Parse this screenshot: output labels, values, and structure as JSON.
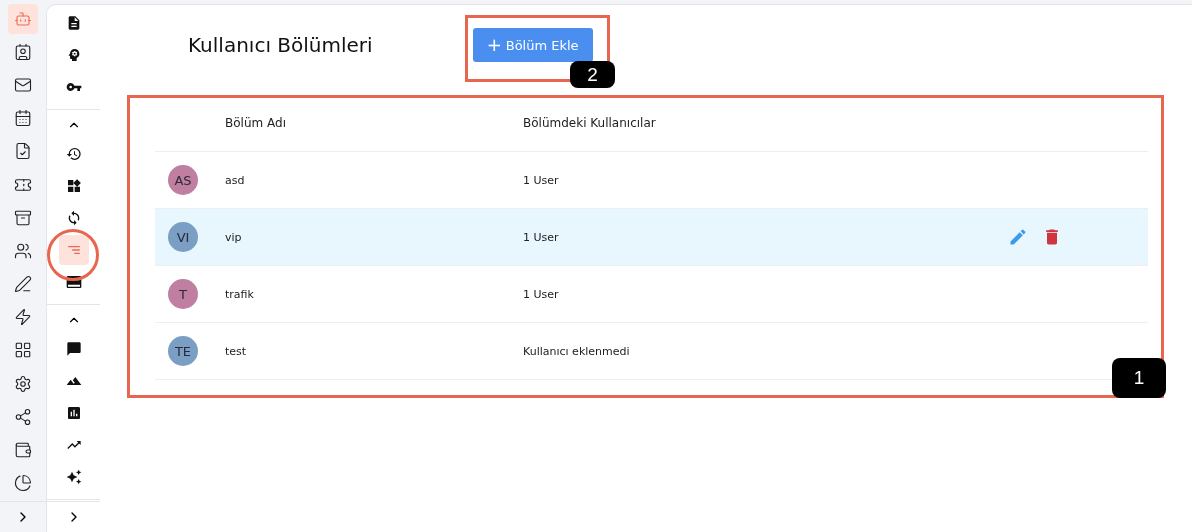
{
  "primary_nav": [
    {
      "selected": true
    },
    {
      "selected": false
    },
    {
      "selected": false
    },
    {
      "selected": false
    },
    {
      "selected": false
    },
    {
      "selected": false
    },
    {
      "selected": false
    },
    {
      "selected": false
    },
    {
      "selected": false
    },
    {
      "selected": false
    },
    {
      "selected": false
    },
    {
      "selected": false
    },
    {
      "selected": false
    },
    {
      "selected": false
    },
    {
      "selected": false
    }
  ],
  "secondary_nav": {
    "groups": [
      {
        "items": [
          {
            "selected": false
          },
          {
            "selected": false
          },
          {
            "selected": false
          }
        ]
      },
      {
        "items": [
          {
            "selected": false
          },
          {
            "selected": false
          },
          {
            "selected": false
          },
          {
            "selected": true
          },
          {
            "selected": false
          }
        ]
      },
      {
        "items": [
          {
            "selected": false
          },
          {
            "selected": false
          },
          {
            "selected": false
          },
          {
            "selected": false
          },
          {
            "selected": false
          }
        ]
      }
    ]
  },
  "page": {
    "title": "Kullanıcı Bölümleri",
    "add_button": {
      "icon": "+",
      "label": "Bölüm Ekle"
    }
  },
  "table": {
    "columns": [
      "Bölüm Adı",
      "Bölümdeki Kullanıcılar"
    ],
    "rows": [
      {
        "initials": "AS",
        "color": "#c07fa0",
        "name": "asd",
        "users": "1 User",
        "highlighted": false
      },
      {
        "initials": "VI",
        "color": "#7a9ec4",
        "name": "vip",
        "users": "1 User",
        "highlighted": true
      },
      {
        "initials": "T",
        "color": "#c07fa0",
        "name": "trafik",
        "users": "1 User",
        "highlighted": false
      },
      {
        "initials": "TE",
        "color": "#7a9ec4",
        "name": "test",
        "users": "Kullanıcı eklenmedi",
        "highlighted": false
      }
    ]
  },
  "annotations": [
    {
      "kind": "box",
      "label": "1"
    },
    {
      "kind": "box",
      "label": "2"
    },
    {
      "kind": "circle"
    }
  ]
}
